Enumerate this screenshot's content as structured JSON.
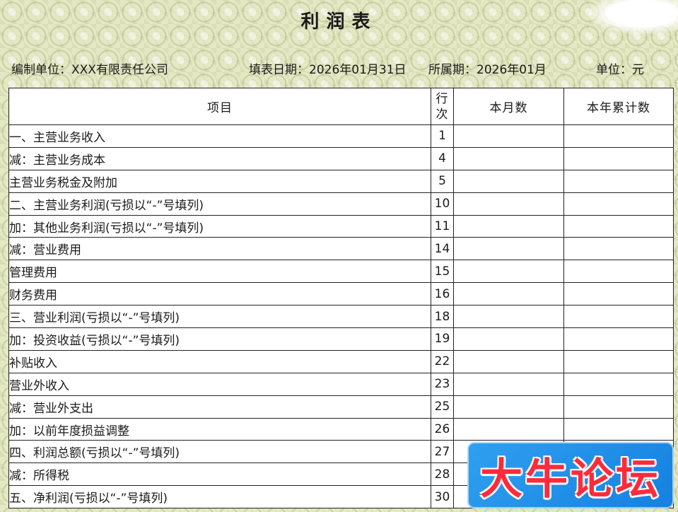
{
  "title": "利润表",
  "meta": {
    "unit_label": "编制单位：XXX有限责任公司",
    "date_label": "填表日期：2026年01月31日",
    "period_label": "所属期：2026年01月",
    "currency_label": "单位：元"
  },
  "table": {
    "headers": {
      "item": "项目",
      "line_no_top": "行",
      "line_no_bottom": "次",
      "this_month": "本月数",
      "ytd": "本年累计数"
    },
    "rows": [
      {
        "item": "一、主营业务收入",
        "line": "1",
        "level": 0,
        "this_month": "",
        "ytd": ""
      },
      {
        "item": "减：主营业务成本",
        "line": "4",
        "level": 1,
        "this_month": "",
        "ytd": ""
      },
      {
        "item": "主营业务税金及附加",
        "line": "5",
        "level": 2,
        "this_month": "",
        "ytd": ""
      },
      {
        "item": "二、主营业务利润(亏损以“-”号填列)",
        "line": "10",
        "level": 0,
        "this_month": "",
        "ytd": ""
      },
      {
        "item": "加：其他业务利润(亏损以“-”号填列)",
        "line": "11",
        "level": 1,
        "this_month": "",
        "ytd": ""
      },
      {
        "item": "减：营业费用",
        "line": "14",
        "level": 1,
        "this_month": "",
        "ytd": ""
      },
      {
        "item": "管理费用",
        "line": "15",
        "level": 2,
        "this_month": "",
        "ytd": ""
      },
      {
        "item": "财务费用",
        "line": "16",
        "level": 2,
        "this_month": "",
        "ytd": ""
      },
      {
        "item": "三、营业利润(亏损以“-”号填列)",
        "line": "18",
        "level": 0,
        "this_month": "",
        "ytd": ""
      },
      {
        "item": "加：投资收益(亏损以“-”号填列)",
        "line": "19",
        "level": 1,
        "this_month": "",
        "ytd": ""
      },
      {
        "item": "补贴收入",
        "line": "22",
        "level": 2,
        "this_month": "",
        "ytd": ""
      },
      {
        "item": "营业外收入",
        "line": "23",
        "level": 2,
        "this_month": "",
        "ytd": ""
      },
      {
        "item": "减：营业外支出",
        "line": "25",
        "level": 1,
        "this_month": "",
        "ytd": ""
      },
      {
        "item": "加：以前年度损益调整",
        "line": "26",
        "level": 1,
        "this_month": "",
        "ytd": ""
      },
      {
        "item": "四、利润总额(亏损以“-”号填列)",
        "line": "27",
        "level": 0,
        "this_month": "",
        "ytd": ""
      },
      {
        "item": "减：所得税",
        "line": "28",
        "level": 1,
        "this_month": "",
        "ytd": ""
      },
      {
        "item": "五、净利润(亏损以“-”号填列)",
        "line": "30",
        "level": 0,
        "this_month": "",
        "ytd": ""
      }
    ]
  },
  "watermark": {
    "text": "大牛论坛",
    "bg_color": "#1e8ae8",
    "text_color": "#ff2a3a"
  }
}
